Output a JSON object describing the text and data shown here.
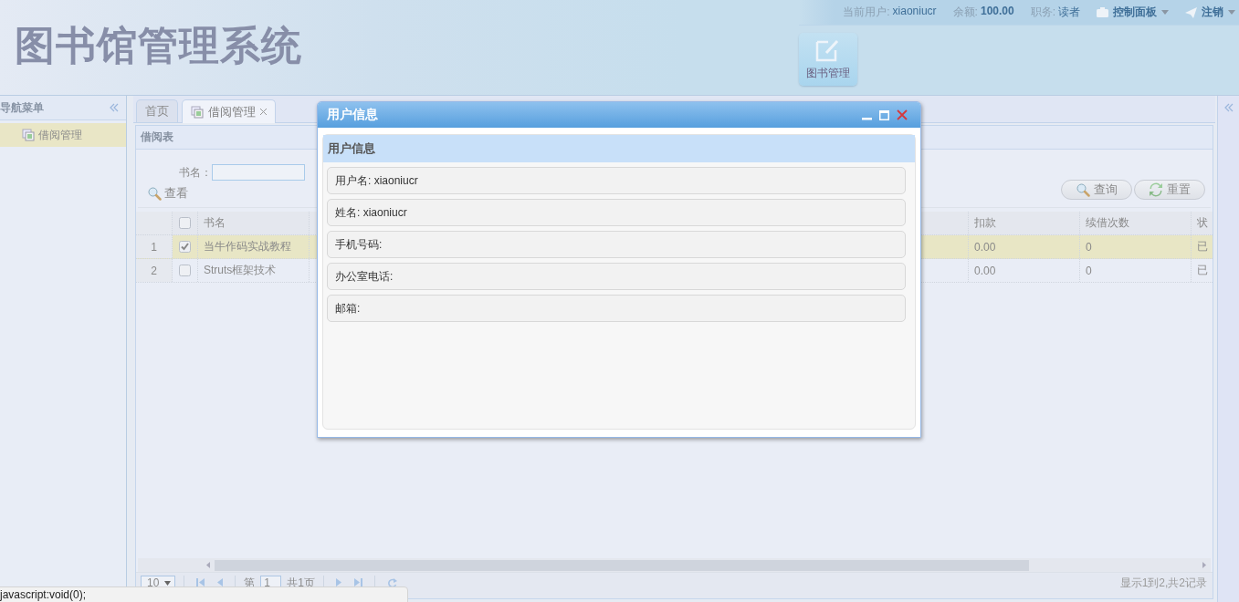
{
  "header": {
    "title": "图书馆管理系统",
    "user_label": "当前用户:",
    "user": "xiaoniucr",
    "balance_label": "余额:",
    "balance": "100.00",
    "role_label": "职务:",
    "role": "读者",
    "menus": [
      "控制面板",
      "注销"
    ],
    "tiles": [
      {
        "label": "图书管理"
      }
    ]
  },
  "nav": {
    "title": "导航菜单",
    "items": [
      {
        "label": "借阅管理",
        "selected": true
      }
    ]
  },
  "tabs": [
    {
      "label": "首页",
      "selected": false,
      "closable": false
    },
    {
      "label": "借阅管理",
      "selected": true,
      "closable": true
    }
  ],
  "panel": {
    "title": "借阅表",
    "search_label": "书名：",
    "view_button": "查看",
    "buttons": [
      {
        "kind": "search",
        "label": "查询"
      },
      {
        "kind": "reset",
        "label": "重置"
      }
    ]
  },
  "table": {
    "all_checked": false,
    "columns": [
      "书名",
      "扣款",
      "续借次数",
      "状"
    ],
    "rows": [
      {
        "index": "1",
        "checked": true,
        "selected": true,
        "cells": [
          "当牛作码实战教程",
          "0.00",
          "0",
          "已"
        ]
      },
      {
        "index": "2",
        "checked": false,
        "selected": false,
        "cells": [
          "Struts框架技术",
          "0.00",
          "0",
          "已"
        ]
      }
    ]
  },
  "pager": {
    "page_size": "10",
    "page_label": "第",
    "page": "1",
    "total_pages": "共1页",
    "summary": "显示1到2,共2记录"
  },
  "dialog": {
    "title": "用户信息",
    "panel_title": "用户信息",
    "fields": [
      {
        "label": "用户名:",
        "value": "xiaoniucr"
      },
      {
        "label": "姓名:",
        "value": "xiaoniucr"
      },
      {
        "label": "手机号码:"
      },
      {
        "label": "办公室电话:"
      },
      {
        "label": "邮箱:"
      }
    ]
  },
  "status_bubble": "javascript:void(0);"
}
